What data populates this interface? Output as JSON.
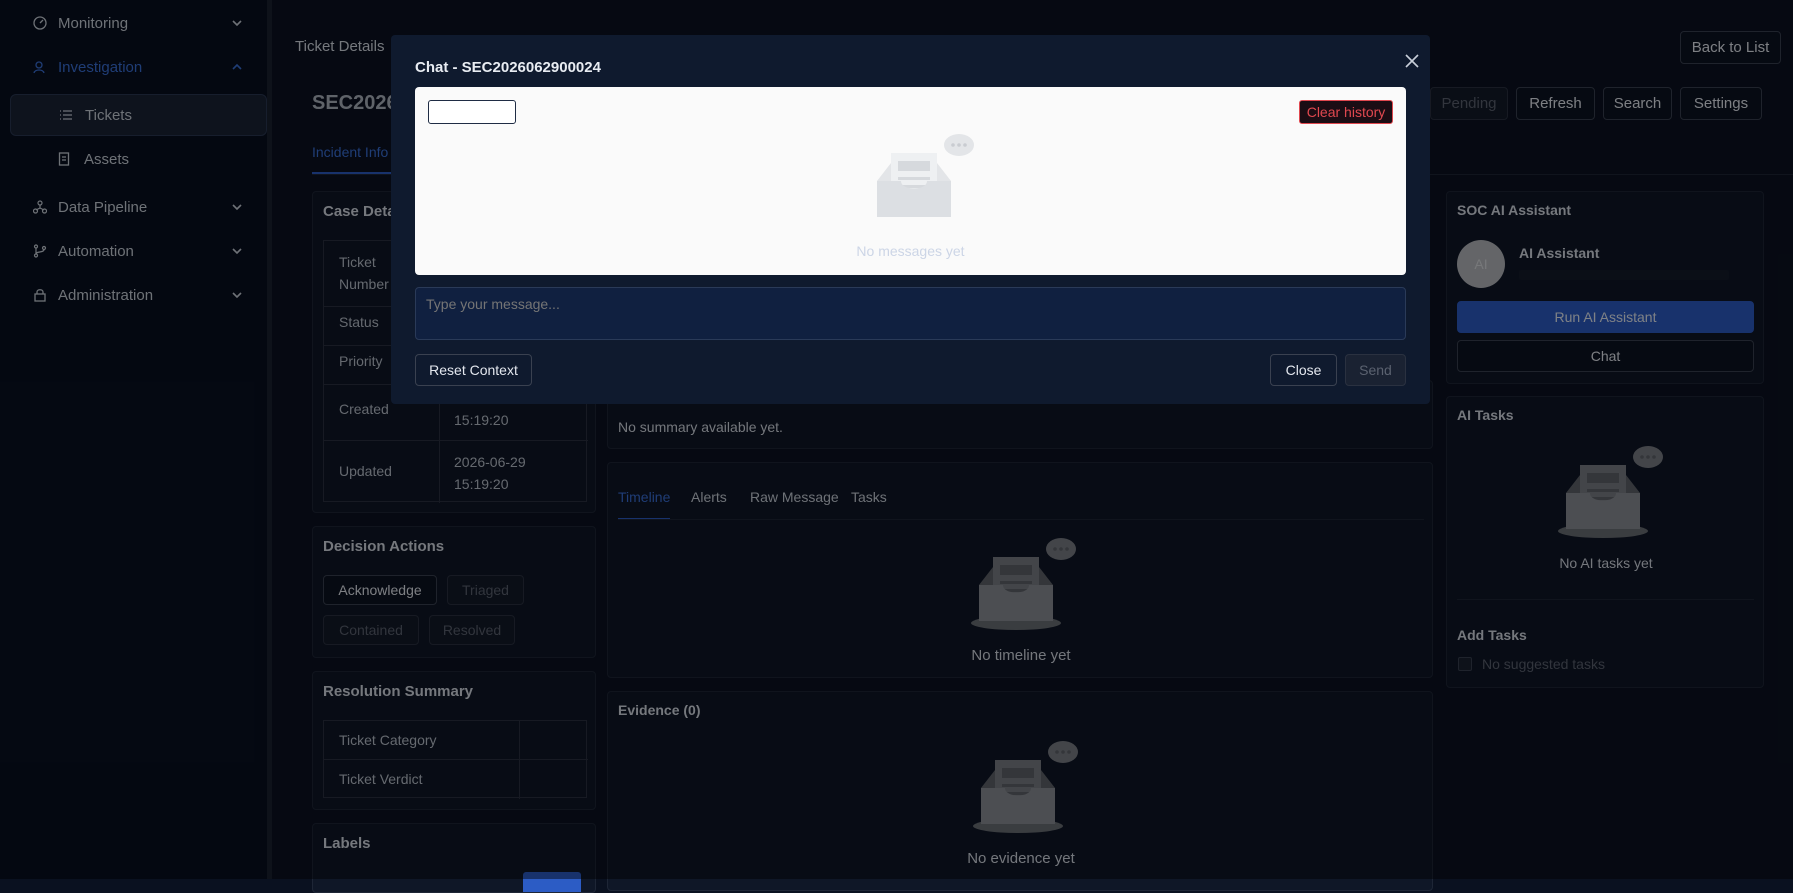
{
  "sidebar": {
    "items": [
      {
        "label": "Monitoring",
        "icon": "dashboard-icon"
      },
      {
        "label": "Investigation",
        "icon": "user-search-icon"
      },
      {
        "label": "Tickets",
        "icon": "list-icon"
      },
      {
        "label": "Assets",
        "icon": "document-icon"
      },
      {
        "label": "Data Pipeline",
        "icon": "network-icon"
      },
      {
        "label": "Automation",
        "icon": "branch-icon"
      },
      {
        "label": "Administration",
        "icon": "lock-icon"
      }
    ]
  },
  "header": {
    "page_title": "Ticket Details",
    "back_label": "Back to List",
    "ticket_id_partial": "SEC2026",
    "actions": {
      "pending": "Pending",
      "refresh": "Refresh",
      "search": "Search",
      "settings": "Settings"
    },
    "tab_incident": "Incident Info"
  },
  "case_details": {
    "title": "Case Detai",
    "rows": [
      {
        "label": "Ticket Number",
        "value": ""
      },
      {
        "label": "Status",
        "value": ""
      },
      {
        "label": "Priority",
        "value": ""
      },
      {
        "label": "Created",
        "value": "15:19:20"
      },
      {
        "label": "Updated",
        "value": "2026-06-29 15:19:20"
      }
    ]
  },
  "decision": {
    "title": "Decision Actions",
    "acknowledge": "Acknowledge",
    "triaged": "Triaged",
    "contained": "Contained",
    "resolved": "Resolved"
  },
  "resolution": {
    "title": "Resolution Summary",
    "category": "Ticket Category",
    "verdict": "Ticket Verdict"
  },
  "labels": {
    "title": "Labels"
  },
  "summary": {
    "text": "No summary available yet."
  },
  "activity_tabs": {
    "timeline": "Timeline",
    "alerts": "Alerts",
    "raw": "Raw Message",
    "tasks": "Tasks",
    "empty": "No timeline yet"
  },
  "evidence": {
    "title": "Evidence (0)",
    "empty": "No evidence yet"
  },
  "ai_panel": {
    "title": "SOC AI Assistant",
    "avatar": "AI",
    "name": "AI Assistant",
    "run": "Run AI Assistant",
    "chat": "Chat"
  },
  "ai_tasks": {
    "title": "AI Tasks",
    "empty": "No AI tasks yet",
    "add_title": "Add Tasks",
    "no_suggested": "No suggested tasks"
  },
  "modal": {
    "title": "Chat - SEC2026062900024",
    "clear_history": "Clear history",
    "no_messages": "No messages yet",
    "placeholder": "Type your message...",
    "reset": "Reset Context",
    "close": "Close",
    "send": "Send"
  },
  "colors": {
    "accent": "#2c5cc5",
    "danger": "#e0484f",
    "bg": "#0a1120"
  }
}
